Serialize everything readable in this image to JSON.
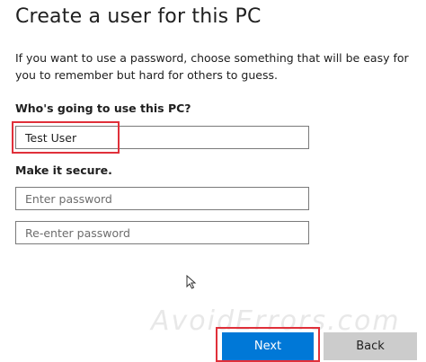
{
  "page": {
    "title": "Create a user for this PC",
    "description": "If you want to use a password, choose something that will be easy for you to remember but hard for others to guess."
  },
  "user_section": {
    "label": "Who's going to use this PC?",
    "username_value": "Test User"
  },
  "security_section": {
    "label": "Make it secure.",
    "password_placeholder": "Enter password",
    "repassword_placeholder": "Re-enter password"
  },
  "buttons": {
    "next_label": "Next",
    "back_label": "Back"
  },
  "watermark": "AvoidErrors.com",
  "colors": {
    "accent": "#0078d7",
    "highlight": "#e0303a",
    "secondary_button": "#cccccc"
  },
  "icons": {
    "cursor": "mouse-pointer-icon"
  }
}
